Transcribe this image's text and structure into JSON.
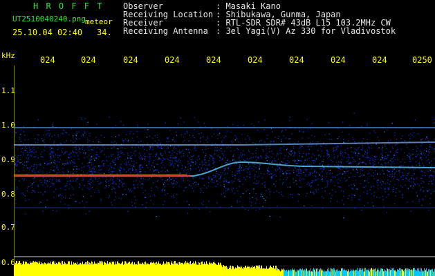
{
  "header": {
    "brand": "H R O F F T",
    "filename": "UT2510040240.png",
    "meteor_label": "meteor",
    "datetime": "25.10.04 02:40",
    "count": "34.",
    "fields": [
      {
        "label": "Observer",
        "value": ": Masaki Kano"
      },
      {
        "label": "Receiving Location",
        "value": ": Shibukawa, Gunma, Japan"
      },
      {
        "label": "Receiver",
        "value": ": RTL-SDR SDR# 43dB L15 103.2MHz CW"
      },
      {
        "label": "Receiving Antenna",
        "value": ": 3el Yagi(V) Az 330 for Vladivostok"
      }
    ]
  },
  "axis": {
    "y_unit": "kHz",
    "y_ticks": [
      "1.1",
      "1.0",
      "0.9",
      "0.8",
      "0.7",
      "0.6"
    ],
    "x_ticks": [
      "024",
      "024",
      "024",
      "024",
      "024",
      "024",
      "024",
      "024",
      "024",
      "0250"
    ]
  },
  "colors": {
    "text_yellow": "#ffff00",
    "text_green": "#33e633",
    "text_white": "#e8e8e8",
    "background": "#000000",
    "noise_blue": "#0a2cc8",
    "signal_red": "#ff3020",
    "level_yellow": "#ffff00",
    "level_cyan": "#00c8ff"
  }
}
